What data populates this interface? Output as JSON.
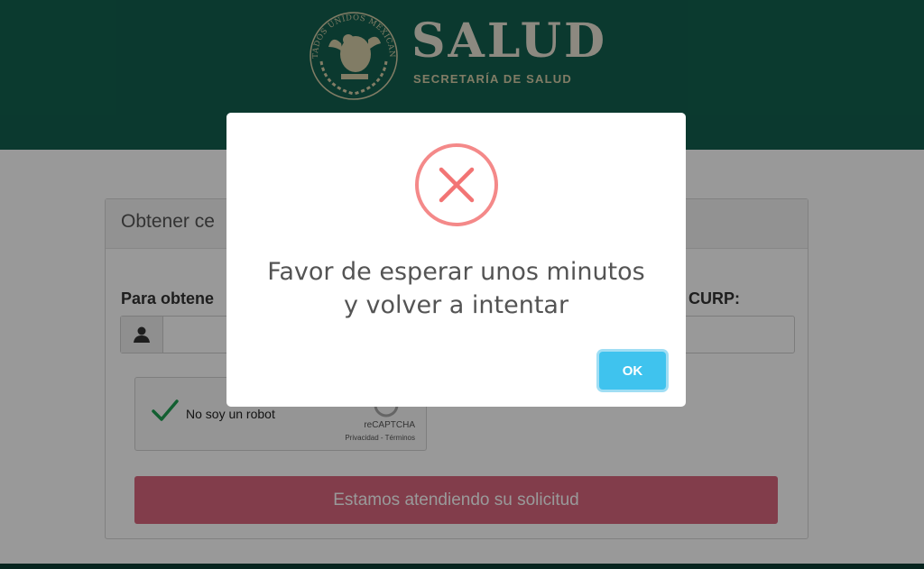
{
  "header": {
    "brand_title": "SALUD",
    "brand_subtitle": "SECRETARÍA DE SALUD",
    "seal_icon": "mexican-coat-of-arms-seal",
    "seal_text": "ESTADOS UNIDOS MEXICANOS"
  },
  "card": {
    "title": "Obtener ce",
    "curp_label_left": "Para obtene",
    "curp_label_right": "CURP:",
    "curp_value": "",
    "user_icon": "user-icon"
  },
  "recaptcha": {
    "label": "No soy un robot",
    "brand": "reCAPTCHA",
    "links": "Privacidad - Términos",
    "checked": true
  },
  "submit": {
    "label": "Estamos atendiendo su solicitud"
  },
  "modal": {
    "icon": "error-x-icon",
    "message_line1": "Favor de esperar unos minutos",
    "message_line2": "y volver a intentar",
    "ok_label": "OK"
  },
  "colors": {
    "header_bg": "#13604f",
    "brand_text": "#e9e4d6",
    "submit_bg": "#d9667e",
    "error_red": "#f27474",
    "ok_blue": "#3fc3ee",
    "check_green": "#1e9e52"
  }
}
